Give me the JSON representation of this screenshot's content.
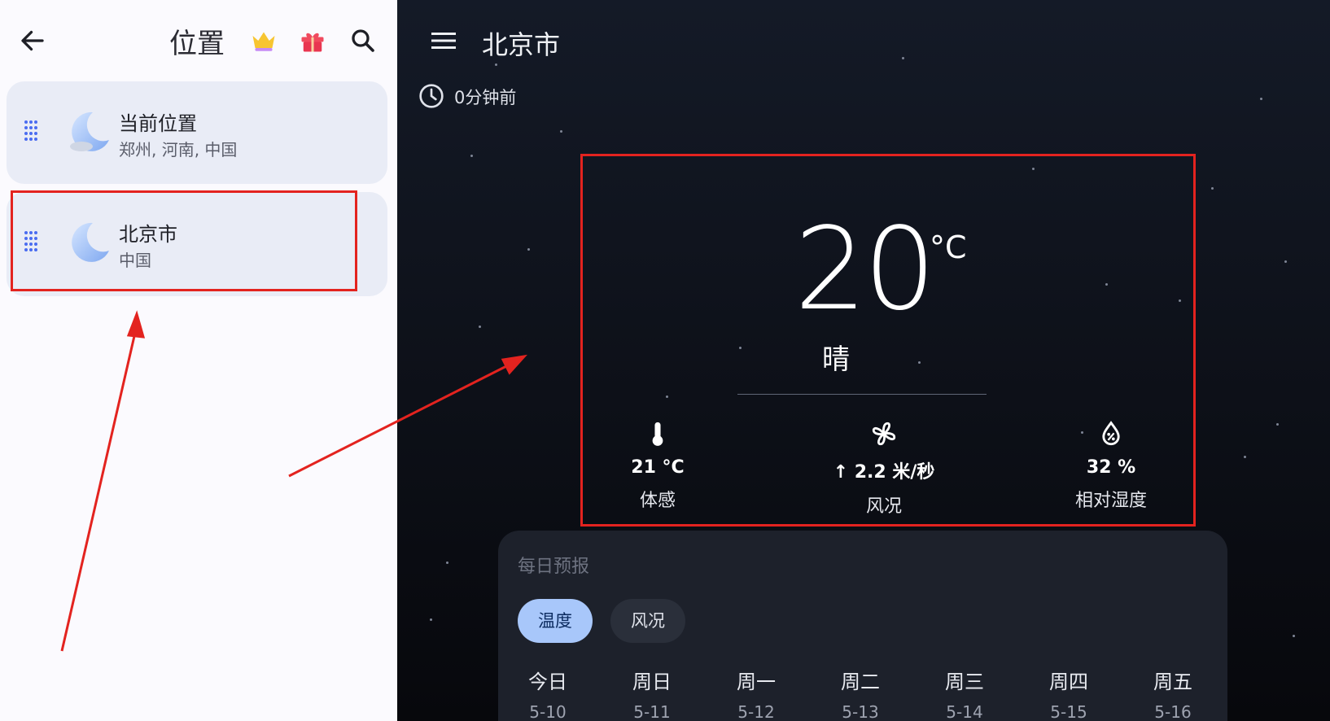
{
  "left_panel": {
    "title": "位置",
    "locations": [
      {
        "name": "当前位置",
        "subtitle": "郑州, 河南, 中国"
      },
      {
        "name": "北京市",
        "subtitle": "中国"
      }
    ]
  },
  "right_panel": {
    "city": "北京市",
    "updated": "0分钟前",
    "current": {
      "temperature": "20",
      "unit": "°C",
      "condition": "晴",
      "feels_like": {
        "value": "21 °C",
        "label": "体感"
      },
      "wind": {
        "value": "↑ 2.2 米/秒",
        "label": "风况"
      },
      "humidity": {
        "value": "32 %",
        "label": "相对湿度"
      }
    },
    "daily": {
      "title": "每日预报",
      "tabs": [
        "温度",
        "风况"
      ],
      "selected_tab": "温度",
      "days": [
        {
          "name": "今日",
          "date": "5-10"
        },
        {
          "name": "周日",
          "date": "5-11"
        },
        {
          "name": "周一",
          "date": "5-12"
        },
        {
          "name": "周二",
          "date": "5-13"
        },
        {
          "name": "周三",
          "date": "5-14"
        },
        {
          "name": "周四",
          "date": "5-15"
        },
        {
          "name": "周五",
          "date": "5-16"
        }
      ]
    }
  },
  "colors": {
    "highlight_red": "#e3231f",
    "accent_blue": "#a8c7fa",
    "card_bg": "#e9ecf6"
  }
}
